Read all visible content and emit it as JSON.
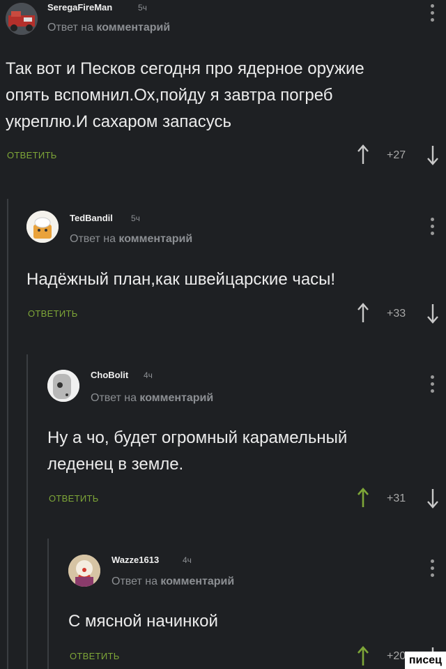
{
  "comments": [
    {
      "username": "SeregaFireMan",
      "time": "5ч",
      "meta_prefix": "Ответ на",
      "meta_link": "комментарий",
      "lines": [
        "Так вот и Песков сегодня про ядерное оружие",
        "опять вспомнил.Ох,пойду я завтра погреб",
        "укреплю.И сахаром запасусь"
      ],
      "reply_label": "ОТВЕТИТЬ",
      "rating": "+27",
      "upvoted": false
    },
    {
      "username": "TedBandil",
      "time": "5ч",
      "meta_prefix": "Ответ на",
      "meta_link": "комментарий",
      "lines": [
        "Надёжный план,как швейцарские часы!"
      ],
      "reply_label": "ОТВЕТИТЬ",
      "rating": "+33",
      "upvoted": false
    },
    {
      "username": "ChoBolit",
      "time": "4ч",
      "meta_prefix": "Ответ на",
      "meta_link": "комментарий",
      "lines": [
        "Ну а чо, будет огромный карамельный",
        "леденец в земле."
      ],
      "reply_label": "ОТВЕТИТЬ",
      "rating": "+31",
      "upvoted": true
    },
    {
      "username": "Wazze1613",
      "time": "4ч",
      "meta_prefix": "Ответ на",
      "meta_link": "комментарий",
      "lines": [
        "С мясной начинкой"
      ],
      "reply_label": "ОТВЕТИТЬ",
      "rating": "+20",
      "upvoted": true
    }
  ],
  "colors": {
    "background": "#1e2023",
    "reply_green": "#7ea638",
    "upvote_active": "#7ea638",
    "arrow_inactive": "#c9c9c9"
  },
  "watermark": "писец"
}
